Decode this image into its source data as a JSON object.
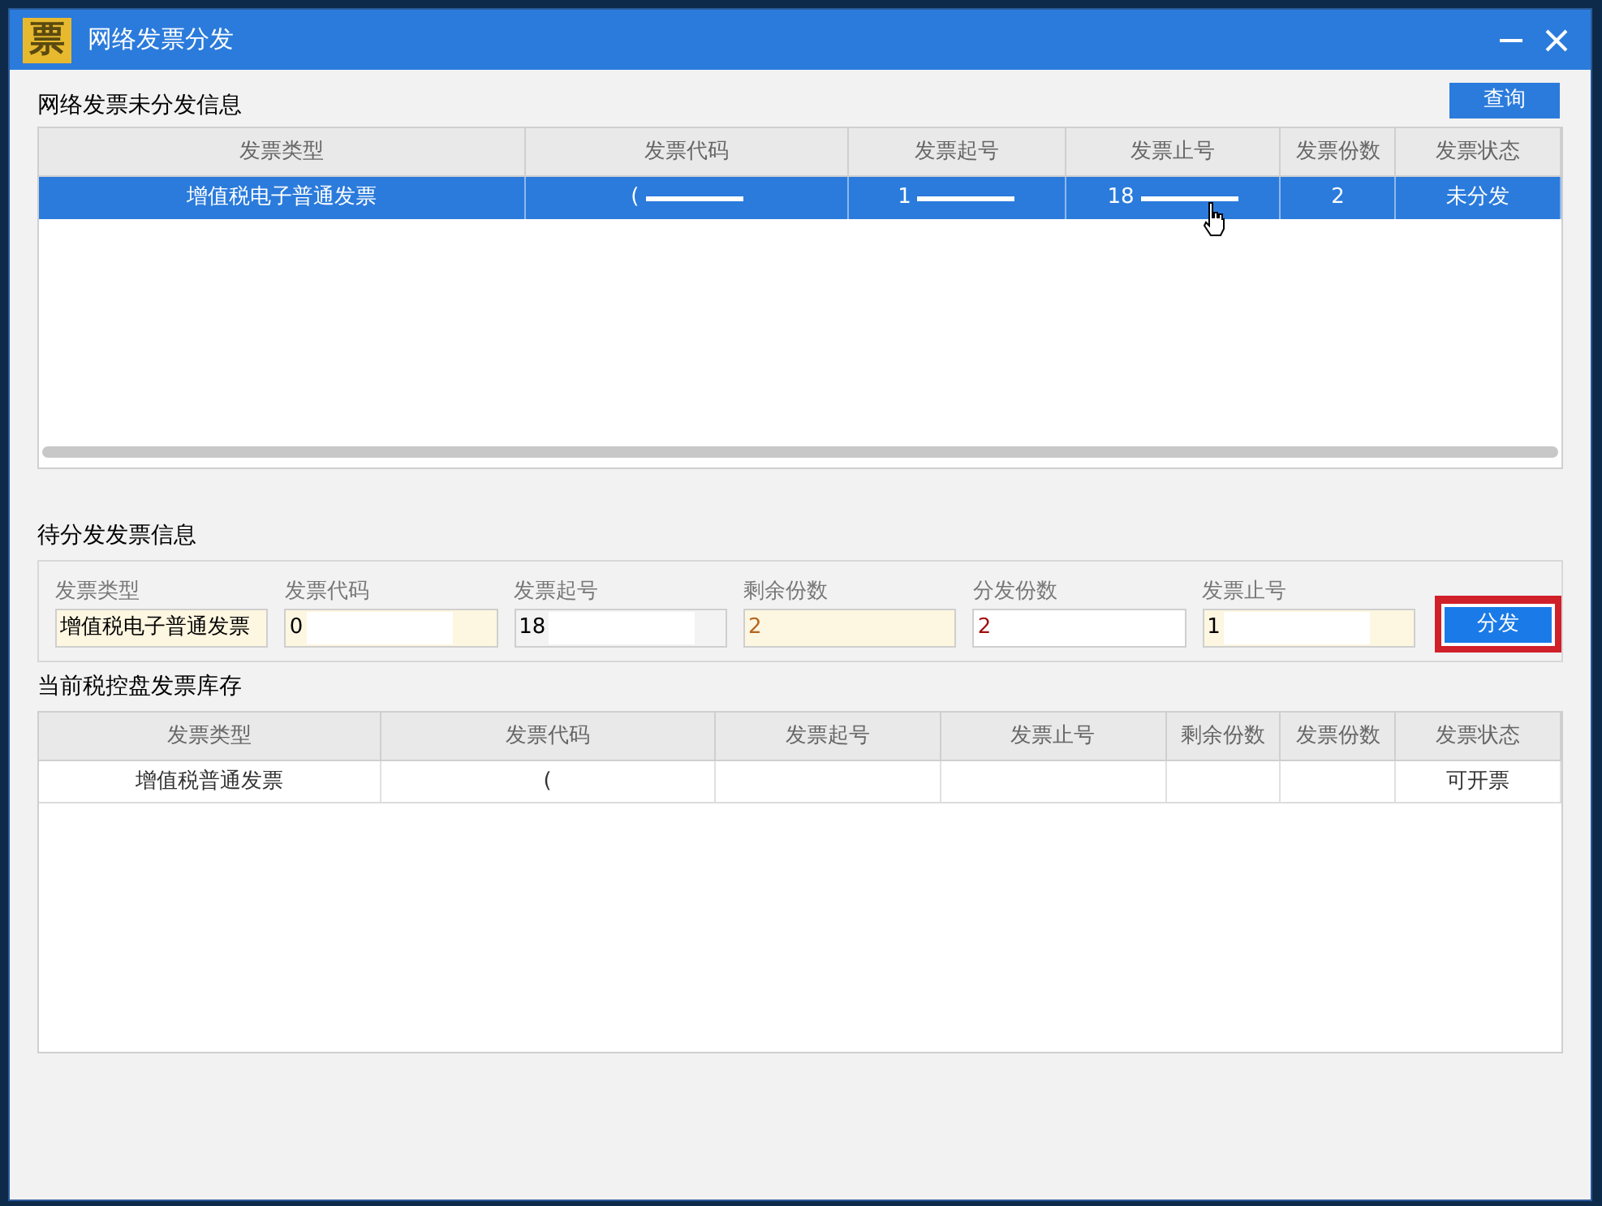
{
  "window": {
    "title": "网络发票分发",
    "logo": "票"
  },
  "pending": {
    "title": "网络发票未分发信息",
    "query_button": "查询",
    "columns": [
      "发票类型",
      "发票代码",
      "发票起号",
      "发票止号",
      "发票份数",
      "发票状态"
    ],
    "rows": [
      {
        "selected": true,
        "cells": [
          {
            "text": "增值税电子普通发票"
          },
          {
            "text": "(",
            "redacted": true
          },
          {
            "text": "1",
            "redacted": true
          },
          {
            "text": "18",
            "redacted": true
          },
          {
            "text": "2"
          },
          {
            "text": "未分发"
          }
        ]
      }
    ]
  },
  "distribute": {
    "title": "待分发发票信息",
    "button": "分发",
    "button_highlighted": true,
    "fields": [
      {
        "label": "发票类型",
        "value": "增值税电子普通发票",
        "readonly": true,
        "redacted": false,
        "color": "#000000"
      },
      {
        "label": "发票代码",
        "value": "0",
        "readonly": true,
        "redacted": true,
        "color": "#000000"
      },
      {
        "label": "发票起号",
        "value": "18",
        "readonly": false,
        "redacted": true,
        "color": "#000000"
      },
      {
        "label": "剩余份数",
        "value": "2",
        "readonly": true,
        "redacted": false,
        "color": "#b5651d"
      },
      {
        "label": "分发份数",
        "value": "2",
        "readonly": false,
        "redacted": false,
        "color": "#a01010"
      },
      {
        "label": "发票止号",
        "value": "1",
        "readonly": true,
        "redacted": true,
        "color": "#000000"
      }
    ]
  },
  "stock": {
    "title": "当前税控盘发票库存",
    "columns": [
      "发票类型",
      "发票代码",
      "发票起号",
      "发票止号",
      "剩余份数",
      "发票份数",
      "发票状态"
    ],
    "rows": [
      {
        "selected": false,
        "cells": [
          {
            "text": "增值税普通发票"
          },
          {
            "text": "("
          },
          {},
          {},
          {},
          {},
          {
            "text": "可开票"
          }
        ]
      }
    ]
  }
}
